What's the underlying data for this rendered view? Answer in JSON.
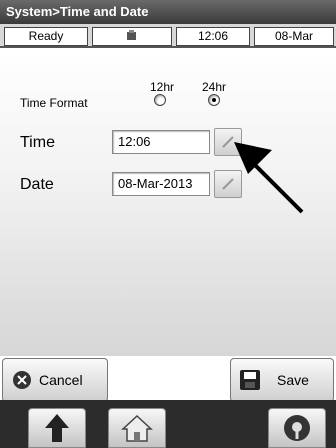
{
  "titlebar": {
    "title": "System>Time and Date"
  },
  "statusbar": {
    "state": "Ready",
    "icon": "device-status-icon",
    "time": "12:06",
    "date": "08-Mar"
  },
  "time_format": {
    "label": "Time Format",
    "options": [
      {
        "label": "12hr",
        "selected": false
      },
      {
        "label": "24hr",
        "selected": true
      }
    ]
  },
  "time": {
    "label": "Time",
    "value": "12:06"
  },
  "date": {
    "label": "Date",
    "value": "08-Mar-2013"
  },
  "buttons": {
    "cancel": "Cancel",
    "save": "Save"
  },
  "nav": {
    "icons": [
      "up-arrow-icon",
      "home-icon",
      "settings-icon"
    ]
  }
}
